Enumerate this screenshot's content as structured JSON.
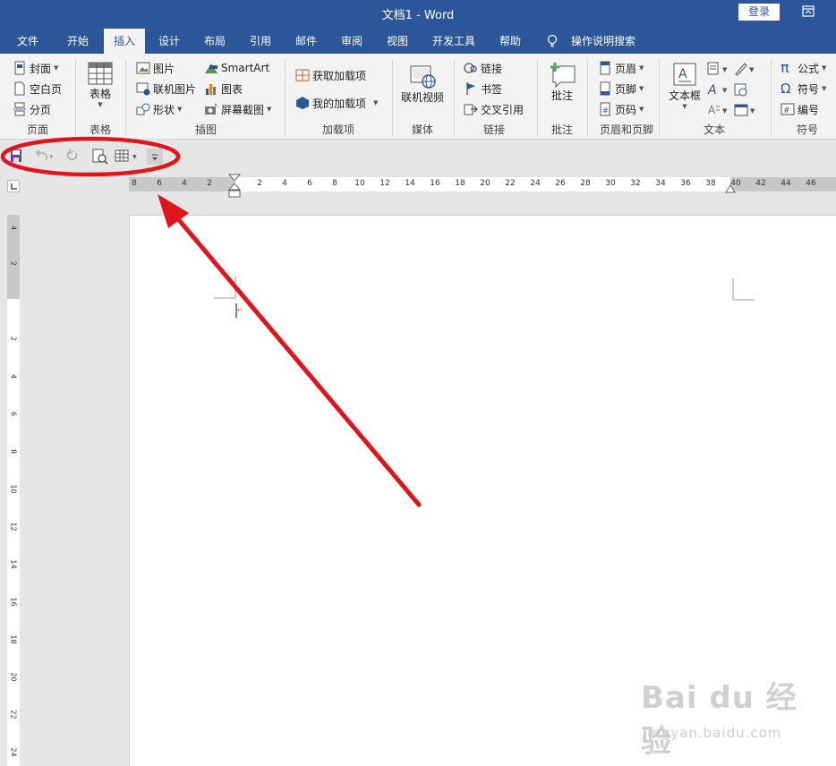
{
  "window": {
    "title": "文档1  -  Word",
    "login_label": "登录"
  },
  "tabs": [
    {
      "label": "文件"
    },
    {
      "label": "开始"
    },
    {
      "label": "插入",
      "active": true
    },
    {
      "label": "设计"
    },
    {
      "label": "布局"
    },
    {
      "label": "引用"
    },
    {
      "label": "邮件"
    },
    {
      "label": "审阅"
    },
    {
      "label": "视图"
    },
    {
      "label": "开发工具"
    },
    {
      "label": "帮助"
    },
    {
      "label": "操作说明搜索"
    }
  ],
  "ribbon": {
    "pages": {
      "cover": "封面",
      "blank": "空白页",
      "break": "分页",
      "group": "页面"
    },
    "tables": {
      "table": "表格",
      "group": "表格"
    },
    "illustrations": {
      "picture": "图片",
      "online_picture": "联机图片",
      "shapes": "形状",
      "smartart": "SmartArt",
      "chart": "图表",
      "screenshot": "屏幕截图",
      "group": "插图"
    },
    "addins": {
      "get": "获取加载项",
      "my": "我的加载项",
      "group": "加载项"
    },
    "media": {
      "video": "联机视频",
      "group": "媒体"
    },
    "links": {
      "link": "链接",
      "bookmark": "书签",
      "crossref": "交叉引用",
      "group": "链接"
    },
    "comments": {
      "comment": "批注",
      "group": "批注"
    },
    "header_footer": {
      "header": "页眉",
      "footer": "页脚",
      "page_number": "页码",
      "group": "页眉和页脚"
    },
    "text": {
      "textbox": "文本框",
      "group": "文本"
    },
    "symbols": {
      "equation": "公式",
      "symbol": "符号",
      "number": "编号",
      "group": "符号"
    }
  },
  "ruler": {
    "horizontal_left": [
      "8",
      "6",
      "4",
      "2"
    ],
    "horizontal_right": [
      "2",
      "4",
      "6",
      "8",
      "10",
      "12",
      "14",
      "16",
      "18",
      "20",
      "22",
      "24",
      "26",
      "28",
      "30",
      "32",
      "34",
      "36",
      "38",
      "40",
      "42",
      "44",
      "46"
    ],
    "vertical_top": [
      "4",
      "2"
    ],
    "vertical_body": [
      "2",
      "4",
      "6",
      "8",
      "10",
      "12",
      "14",
      "16",
      "18",
      "20",
      "22",
      "24"
    ]
  },
  "watermark": {
    "logo": "Bai du 经验",
    "url": "jingyan.baidu.com"
  },
  "colors": {
    "accent": "#2b579a",
    "annotation": "#e0151b"
  }
}
